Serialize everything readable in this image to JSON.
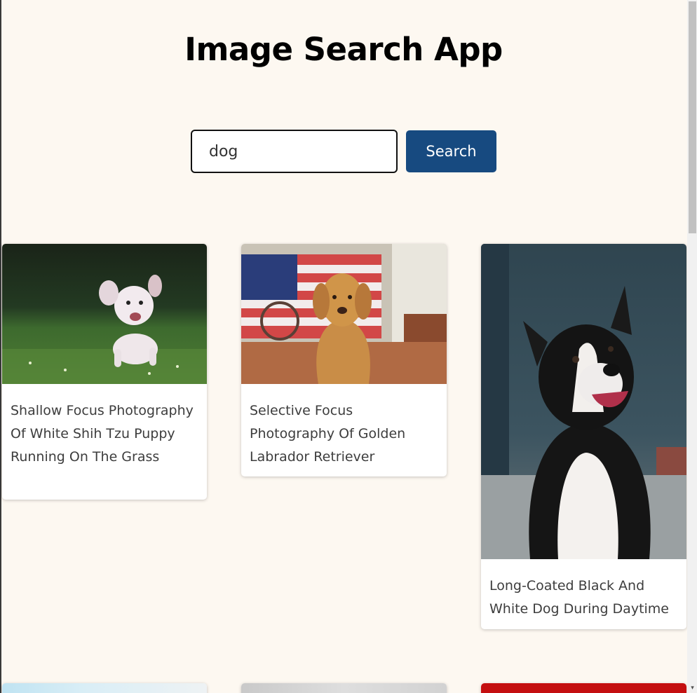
{
  "app": {
    "title": "Image Search App"
  },
  "search": {
    "value": "dog",
    "placeholder": "",
    "button_label": "Search"
  },
  "results": [
    {
      "caption": "Shallow Focus Photography Of White Shih Tzu Puppy Running On The Grass",
      "image": "white-puppy-running-photo"
    },
    {
      "caption": "Selective Focus Photography Of Golden Labrador Retriever",
      "image": "golden-retriever-photo"
    },
    {
      "caption": "Long-Coated Black And White Dog During Daytime",
      "image": "border-collie-photo"
    },
    {
      "caption": "",
      "image": "partial-photo-sky"
    },
    {
      "caption": "",
      "image": "partial-photo-gray"
    },
    {
      "caption": "",
      "image": "partial-photo-red"
    }
  ],
  "colors": {
    "background": "#fdf8f1",
    "button": "#174a80",
    "title": "#000000",
    "caption": "#3d3d3d"
  },
  "scrollbar": {
    "down_arrow": "▾"
  }
}
